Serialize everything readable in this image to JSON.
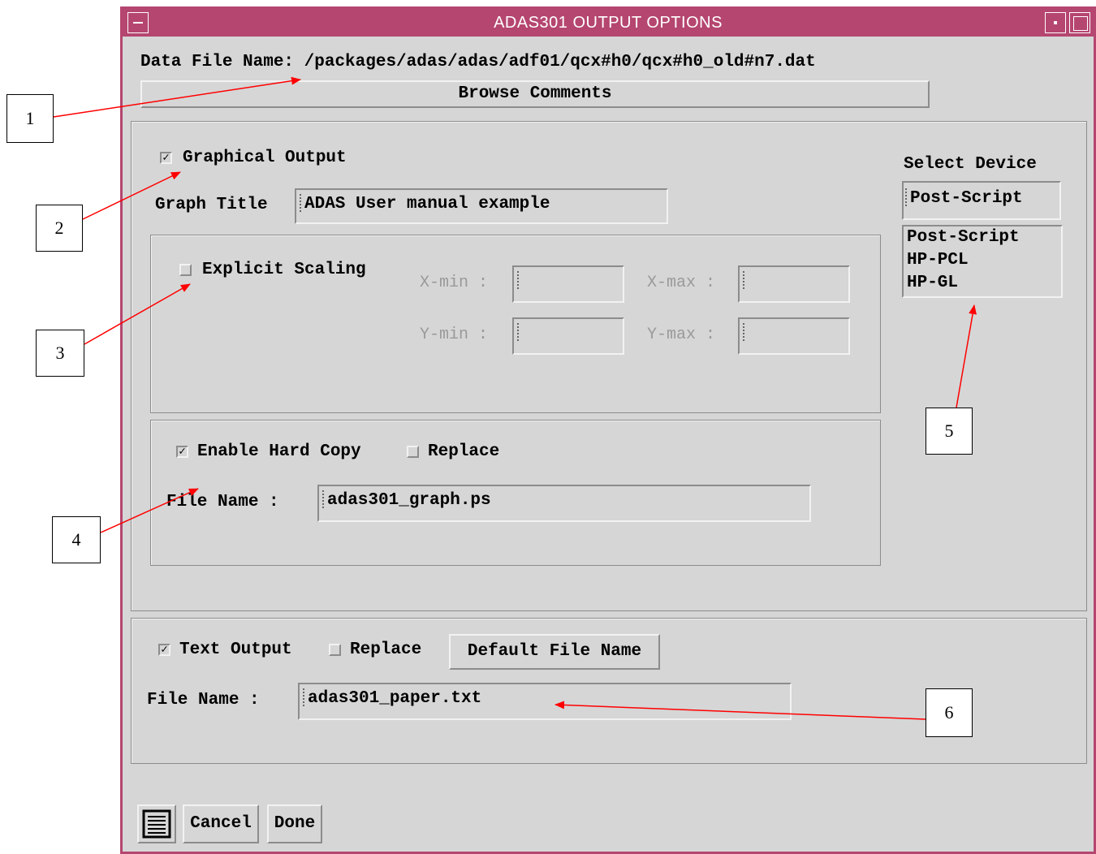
{
  "window": {
    "title": "ADAS301 OUTPUT OPTIONS"
  },
  "data_file": {
    "label": "Data File Name: /packages/adas/adas/adf01/qcx#h0/qcx#h0_old#n7.dat",
    "browse_label": "Browse Comments"
  },
  "graphics": {
    "enabled_label": "Graphical Output",
    "graph_title_label": "Graph Title",
    "graph_title_value": "ADAS User manual example",
    "scaling_label": "Explicit Scaling",
    "xmin_label": "X-min :",
    "xmax_label": "X-max :",
    "ymin_label": "Y-min :",
    "ymax_label": "Y-max :",
    "hardcopy_label": "Enable Hard Copy",
    "replace_label": "Replace",
    "filename_label": "File Name :",
    "filename_value": "adas301_graph.ps"
  },
  "device": {
    "label": "Select Device",
    "selected": "Post-Script",
    "options": [
      "Post-Script",
      "HP-PCL",
      "HP-GL"
    ]
  },
  "text_output": {
    "enabled_label": "Text Output",
    "replace_label": "Replace",
    "default_button": "Default File Name",
    "filename_label": "File Name :",
    "filename_value": "adas301_paper.txt"
  },
  "footer": {
    "cancel": "Cancel",
    "done": "Done",
    "menu_icon": "list-icon"
  },
  "callouts": [
    "1",
    "2",
    "3",
    "4",
    "5",
    "6"
  ],
  "colors": {
    "titlebar": "#b5466f",
    "panel": "#d6d6d6",
    "arrow": "#ff0000"
  }
}
